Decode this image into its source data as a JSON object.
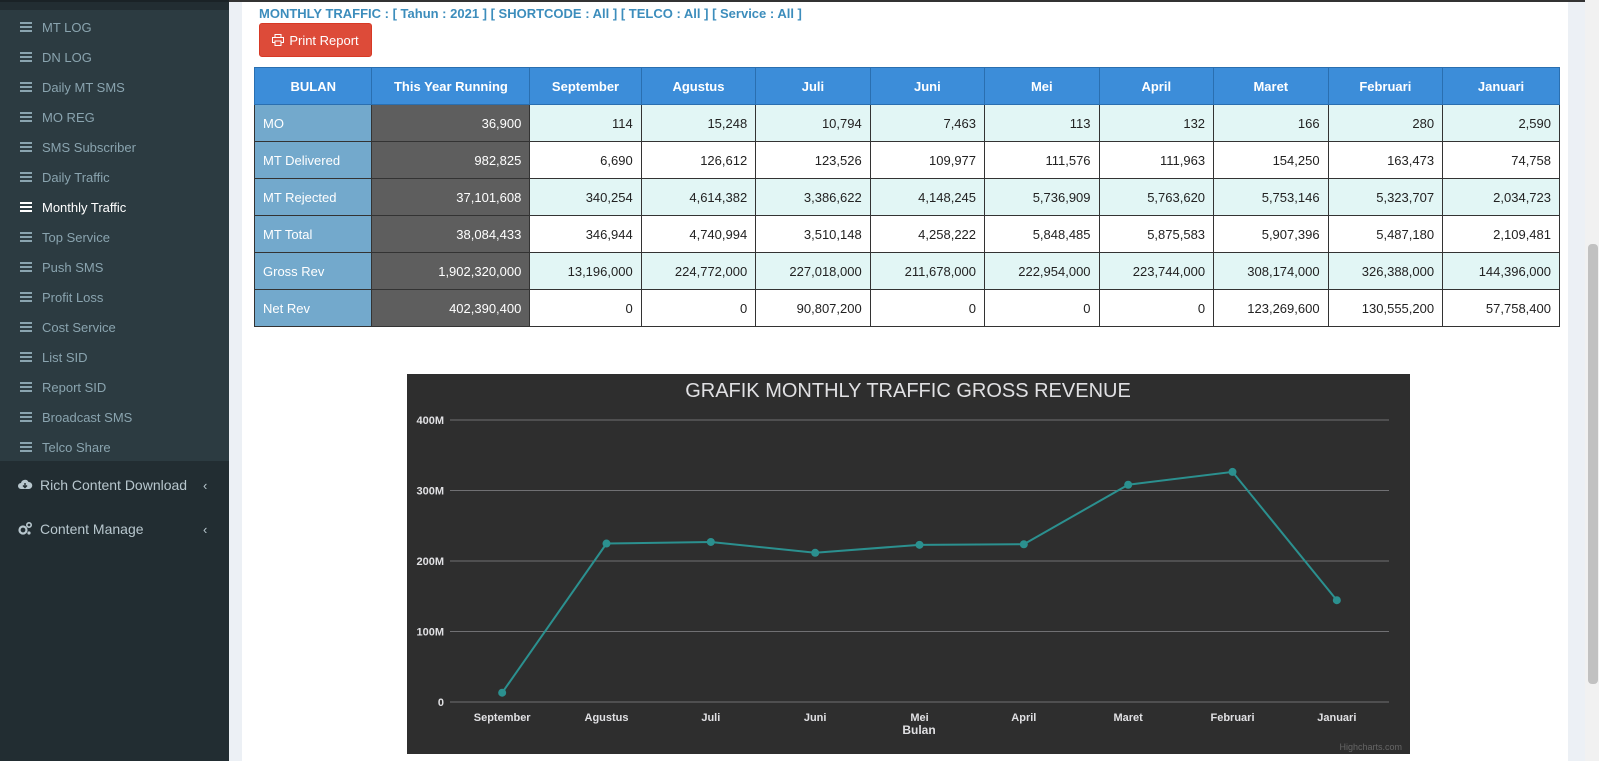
{
  "sidebar": {
    "items": [
      {
        "label": "MT LOG"
      },
      {
        "label": "DN LOG"
      },
      {
        "label": "Daily MT SMS"
      },
      {
        "label": "MO REG"
      },
      {
        "label": "SMS Subscriber"
      },
      {
        "label": "Daily Traffic"
      },
      {
        "label": "Monthly Traffic",
        "active": true
      },
      {
        "label": "Top Service"
      },
      {
        "label": "Push SMS"
      },
      {
        "label": "Profit Loss"
      },
      {
        "label": "Cost Service"
      },
      {
        "label": "List SID"
      },
      {
        "label": "Report SID"
      },
      {
        "label": "Broadcast SMS"
      },
      {
        "label": "Telco Share"
      }
    ],
    "trees": [
      {
        "label": "Rich Content Download",
        "icon": "cloud-download-icon"
      },
      {
        "label": "Content Manage",
        "icon": "gears-icon"
      }
    ]
  },
  "header": {
    "filter_text": "MONTHLY TRAFFIC : [ Tahun : 2021 ] [ SHORTCODE : All ] [ TELCO : All ] [ Service : All ]",
    "print_label": "Print Report"
  },
  "table": {
    "headers": [
      "BULAN",
      "This Year Running",
      "September",
      "Agustus",
      "Juli",
      "Juni",
      "Mei",
      "April",
      "Maret",
      "Februari",
      "Januari"
    ],
    "rows": [
      {
        "label": "MO",
        "ytd": "36,900",
        "values": [
          "114",
          "15,248",
          "10,794",
          "7,463",
          "113",
          "132",
          "166",
          "280",
          "2,590"
        ]
      },
      {
        "label": "MT Delivered",
        "ytd": "982,825",
        "values": [
          "6,690",
          "126,612",
          "123,526",
          "109,977",
          "111,576",
          "111,963",
          "154,250",
          "163,473",
          "74,758"
        ]
      },
      {
        "label": "MT Rejected",
        "ytd": "37,101,608",
        "values": [
          "340,254",
          "4,614,382",
          "3,386,622",
          "4,148,245",
          "5,736,909",
          "5,763,620",
          "5,753,146",
          "5,323,707",
          "2,034,723"
        ]
      },
      {
        "label": "MT Total",
        "ytd": "38,084,433",
        "values": [
          "346,944",
          "4,740,994",
          "3,510,148",
          "4,258,222",
          "5,848,485",
          "5,875,583",
          "5,907,396",
          "5,487,180",
          "2,109,481"
        ]
      },
      {
        "label": "Gross Rev",
        "ytd": "1,902,320,000",
        "values": [
          "13,196,000",
          "224,772,000",
          "227,018,000",
          "211,678,000",
          "222,954,000",
          "223,744,000",
          "308,174,000",
          "326,388,000",
          "144,396,000"
        ]
      },
      {
        "label": "Net Rev",
        "ytd": "402,390,400",
        "values": [
          "0",
          "0",
          "90,807,200",
          "0",
          "0",
          "0",
          "123,269,600",
          "130,555,200",
          "57,758,400"
        ]
      }
    ]
  },
  "chart_data": {
    "type": "line",
    "title": "GRAFIK MONTHLY TRAFFIC GROSS REVENUE",
    "xlabel": "Bulan",
    "ylabel": "",
    "categories": [
      "September",
      "Agustus",
      "Juli",
      "Juni",
      "Mei",
      "April",
      "Maret",
      "Februari",
      "Januari"
    ],
    "series": [
      {
        "values": [
          13196000,
          224772000,
          227018000,
          211678000,
          222954000,
          223744000,
          308174000,
          326388000,
          144396000
        ],
        "color": "#2b908f"
      }
    ],
    "ylim": [
      0,
      400000000
    ],
    "yticks": [
      0,
      100000000,
      200000000,
      300000000,
      400000000
    ],
    "ytick_labels": [
      "0",
      "100M",
      "200M",
      "300M",
      "400M"
    ],
    "grid": true,
    "credits": "Highcharts.com",
    "background": "#2e2e2e"
  }
}
